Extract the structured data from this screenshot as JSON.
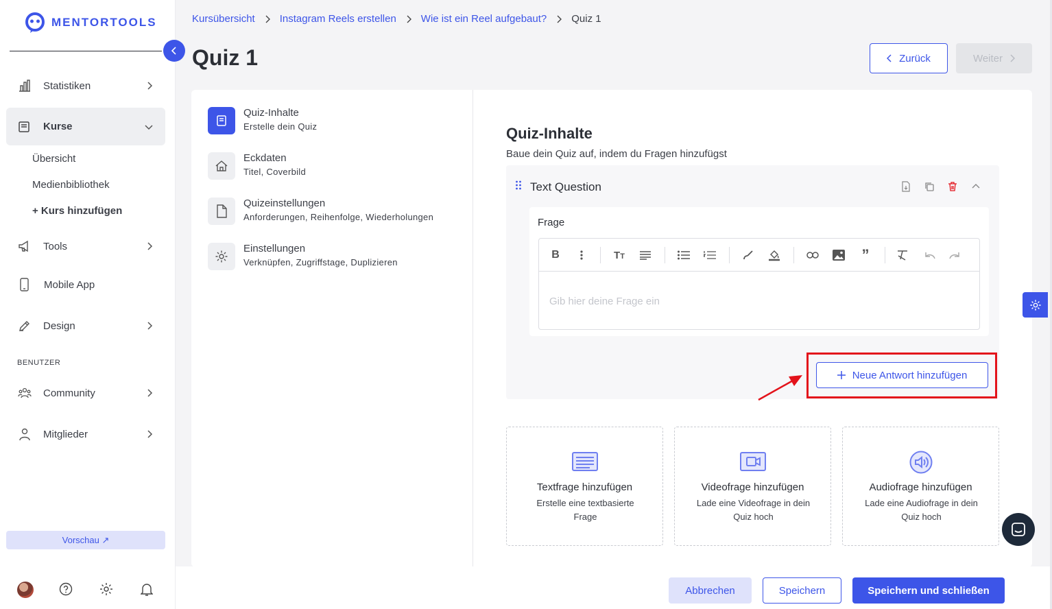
{
  "brand": {
    "name": "MENTORTOOLS",
    "accent": "#3d55e8"
  },
  "sidebar": {
    "items": [
      {
        "label": "Statistiken",
        "icon": "bar-chart-icon"
      },
      {
        "label": "Kurse",
        "icon": "book-icon"
      },
      {
        "label": "Tools",
        "icon": "megaphone-icon"
      },
      {
        "label": "Mobile App",
        "icon": "phone-icon"
      },
      {
        "label": "Design",
        "icon": "pencil-icon"
      },
      {
        "label": "Community",
        "icon": "users-icon"
      },
      {
        "label": "Mitglieder",
        "icon": "user-icon"
      }
    ],
    "sub_items": [
      "Übersicht",
      "Medienbibliothek",
      "+ Kurs hinzufügen"
    ],
    "section_label": "BENUTZER",
    "preview_label": "Vorschau ↗"
  },
  "breadcrumb": [
    "Kursübersicht",
    "Instagram Reels erstellen",
    "Wie ist ein Reel aufgebaut?",
    "Quiz 1"
  ],
  "page": {
    "title": "Quiz 1",
    "back_label": "Zurück",
    "next_label": "Weiter"
  },
  "steps": [
    {
      "title": "Quiz-Inhalte",
      "sub": "Erstelle dein Quiz",
      "icon": "document-icon"
    },
    {
      "title": "Eckdaten",
      "sub": "Titel, Coverbild",
      "icon": "home-icon"
    },
    {
      "title": "Quizeinstellungen",
      "sub": "Anforderungen, Reihenfolge, Wiederholungen",
      "icon": "file-icon"
    },
    {
      "title": "Einstellungen",
      "sub": "Verknüpfen, Zugriffstage, Duplizieren",
      "icon": "gear-icon"
    }
  ],
  "content": {
    "title": "Quiz-Inhalte",
    "subtitle": "Baue dein Quiz auf, indem du Fragen hinzufügst",
    "question": {
      "title": "Text Question",
      "field_label": "Frage",
      "placeholder": "Gib hier deine Frage ein",
      "add_answer_label": "Neue Antwort hinzufügen"
    },
    "types": [
      {
        "title": "Textfrage hinzufügen",
        "sub": "Erstelle eine textbasierte Frage"
      },
      {
        "title": "Videofrage hinzufügen",
        "sub": "Lade eine Videofrage in dein Quiz hoch"
      },
      {
        "title": "Audiofrage hinzufügen",
        "sub": "Lade eine Audiofrage in dein Quiz hoch"
      }
    ]
  },
  "footer": {
    "cancel": "Abbrechen",
    "save": "Speichern",
    "save_close": "Speichern und schließen"
  }
}
